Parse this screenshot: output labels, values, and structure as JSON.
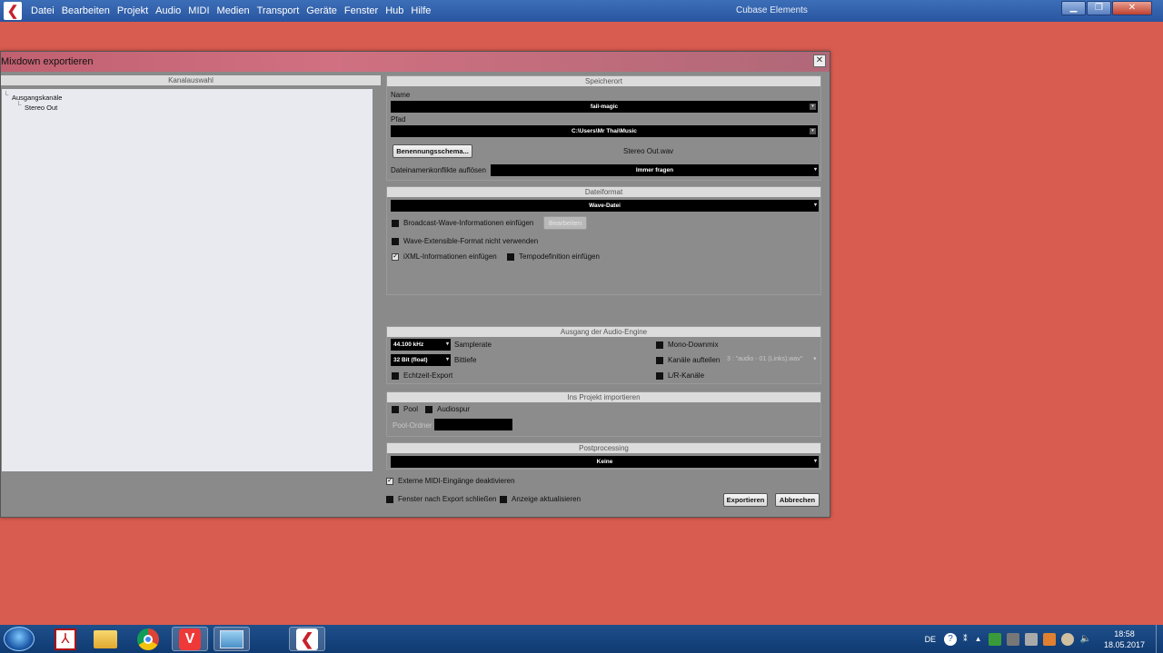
{
  "menubar": {
    "items": [
      "Datei",
      "Bearbeiten",
      "Projekt",
      "Audio",
      "MIDI",
      "Medien",
      "Transport",
      "Geräte",
      "Fenster",
      "Hub",
      "Hilfe"
    ],
    "app_title": "Cubase Elements"
  },
  "dialog": {
    "title": "Mixdown exportieren",
    "left": {
      "header": "Kanalauswahl",
      "tree": [
        "Ausgangskanäle",
        "Stereo Out"
      ]
    },
    "speicherort": {
      "header": "Speicherort",
      "name_label": "Name",
      "name_value": "fail-magic",
      "pfad_label": "Pfad",
      "pfad_value": "C:\\Users\\Mr Thai\\Music",
      "naming_button": "Benennungsschema...",
      "filename_preview": "Stereo Out.wav",
      "conflict_label": "Dateinamenkonflikte auflösen",
      "conflict_value": "Immer fragen"
    },
    "dateiformat": {
      "header": "Dateiformat",
      "format_value": "Wave-Datei",
      "bwf_label": "Broadcast-Wave-Informationen einfügen",
      "bwf_checked": false,
      "edit_button": "Bearbeiten",
      "wavex_label": "Wave-Extensible-Format nicht verwenden",
      "wavex_checked": false,
      "ixml_label": "iXML-Informationen einfügen",
      "ixml_checked": true,
      "tempo_label": "Tempodefinition einfügen",
      "tempo_checked": false
    },
    "audio_engine": {
      "header": "Ausgang der Audio-Engine",
      "samplerate_value": "44.100 kHz",
      "samplerate_label": "Samplerate",
      "bitdepth_value": "32 Bit (float)",
      "bitdepth_label": "Bittiefe",
      "realtime_label": "Echtzeit-Export",
      "realtime_checked": false,
      "mono_label": "Mono-Downmix",
      "mono_checked": false,
      "split_label": "Kanäle aufteilen",
      "split_checked": false,
      "split_value": "3 : \"audio - 01 (Links).wav\"",
      "lr_label": "L/R-Kanäle",
      "lr_checked": false
    },
    "import": {
      "header": "Ins Projekt importieren",
      "pool_label": "Pool",
      "pool_checked": false,
      "audiospur_label": "Audiospur",
      "audiospur_checked": false,
      "pool_folder_label": "Pool-Ordner"
    },
    "postprocessing": {
      "header": "Postprocessing",
      "value": "Keine"
    },
    "footer": {
      "midi_label": "Externe MIDI-Eingänge deaktivieren",
      "midi_checked": true,
      "close_label": "Fenster nach Export schließen",
      "close_checked": false,
      "update_label": "Anzeige aktualisieren",
      "update_checked": false,
      "export_button": "Exportieren",
      "cancel_button": "Abbrechen"
    }
  },
  "taskbar": {
    "apps": [
      "acrobat-icon",
      "explorer-icon",
      "chrome-icon",
      "vivaldi-icon",
      "control-panel-icon",
      "cubase-icon"
    ],
    "language": "DE",
    "time": "18:58",
    "date": "18.05.2017"
  },
  "colors": {
    "desktop": "#d95c50",
    "taskbar": "#1f4f8a",
    "dialog_bg": "#8a8a8a"
  }
}
